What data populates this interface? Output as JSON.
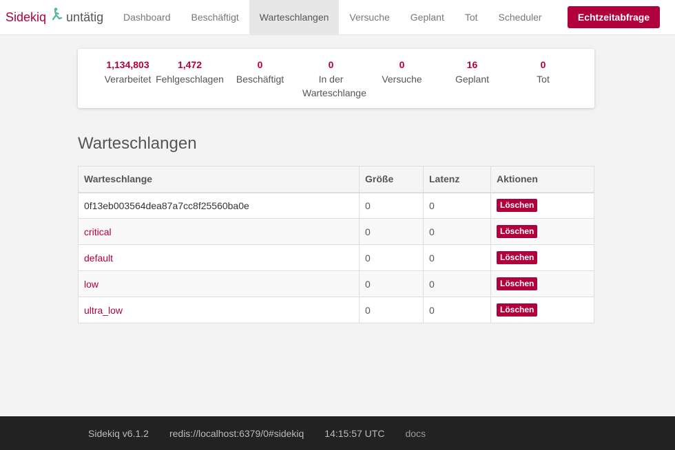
{
  "brand": {
    "name": "Sidekiq",
    "status": "untätig",
    "logo_icon": "running-figure-icon",
    "logo_color": "#55b8a0"
  },
  "nav": {
    "items": [
      {
        "label": "Dashboard"
      },
      {
        "label": "Beschäftigt"
      },
      {
        "label": "Warteschlangen"
      },
      {
        "label": "Versuche"
      },
      {
        "label": "Geplant"
      },
      {
        "label": "Tot"
      },
      {
        "label": "Scheduler"
      }
    ],
    "active_index": 2,
    "poll_label": "Echtzeitabfrage"
  },
  "stats": [
    {
      "value": "1,134,803",
      "label": "Verarbeitet"
    },
    {
      "value": "1,472",
      "label": "Fehlgeschlagen"
    },
    {
      "value": "0",
      "label": "Beschäftigt"
    },
    {
      "value": "0",
      "label": "In der Warteschlange"
    },
    {
      "value": "0",
      "label": "Versuche"
    },
    {
      "value": "16",
      "label": "Geplant"
    },
    {
      "value": "0",
      "label": "Tot"
    }
  ],
  "page_title": "Warteschlangen",
  "table": {
    "headers": [
      "Warteschlange",
      "Größe",
      "Latenz",
      "Aktionen"
    ],
    "rows": [
      {
        "name": "0f13eb003564dea87a7cc8f25560ba0e",
        "size": "0",
        "latency": "0",
        "action": "Löschen"
      },
      {
        "name": "critical",
        "size": "0",
        "latency": "0",
        "action": "Löschen"
      },
      {
        "name": "default",
        "size": "0",
        "latency": "0",
        "action": "Löschen"
      },
      {
        "name": "low",
        "size": "0",
        "latency": "0",
        "action": "Löschen"
      },
      {
        "name": "ultra_low",
        "size": "0",
        "latency": "0",
        "action": "Löschen"
      }
    ]
  },
  "footer": {
    "version": "Sidekiq v6.1.2",
    "redis": "redis://localhost:6379/0#sidekiq",
    "time": "14:15:57 UTC",
    "docs": "docs"
  },
  "colors": {
    "accent": "#b1003e",
    "footer_bg": "#222222"
  }
}
